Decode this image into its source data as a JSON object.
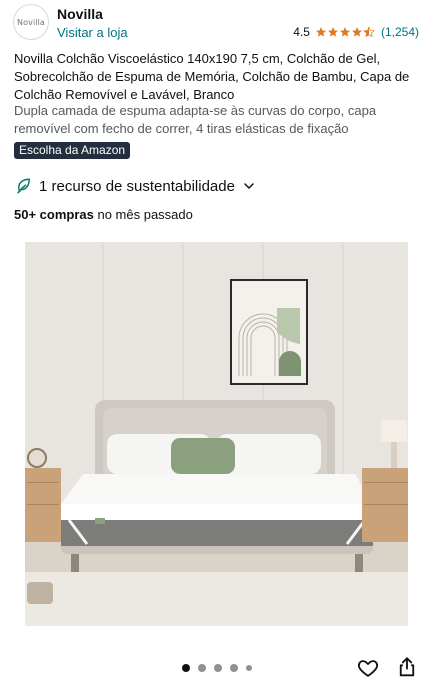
{
  "store": {
    "brand": "Novilla",
    "logo_text": "Novilla",
    "visit_label": "Visitar a loja",
    "rating": "4.5",
    "rating_stars": 4.5,
    "rating_count": "(1,254)"
  },
  "product": {
    "title": "Novilla Colchão Viscoelástico 140x190 7,5 cm, Colchão de Gel, Sobrecolchão de Espuma de Memória, Colchão de Bambu, Capa de Colchão Removível e Lavável, Branco",
    "subtitle": "Dupla camada de espuma adapta-se às curvas do corpo, capa removível com fecho de correr, 4 tiras elásticas de fixação",
    "badge": "Escolha da Amazon"
  },
  "sustainability": {
    "label": "1 recurso de sustentabilidade"
  },
  "purchases": {
    "bold": "50+ compras",
    "rest": " no mês passado"
  },
  "carousel": {
    "total_dots": 5,
    "active_index": 0
  },
  "colors": {
    "link": "#007185",
    "star": "#de7921",
    "badge_bg": "#232f3e",
    "leaf": "#067d62"
  }
}
